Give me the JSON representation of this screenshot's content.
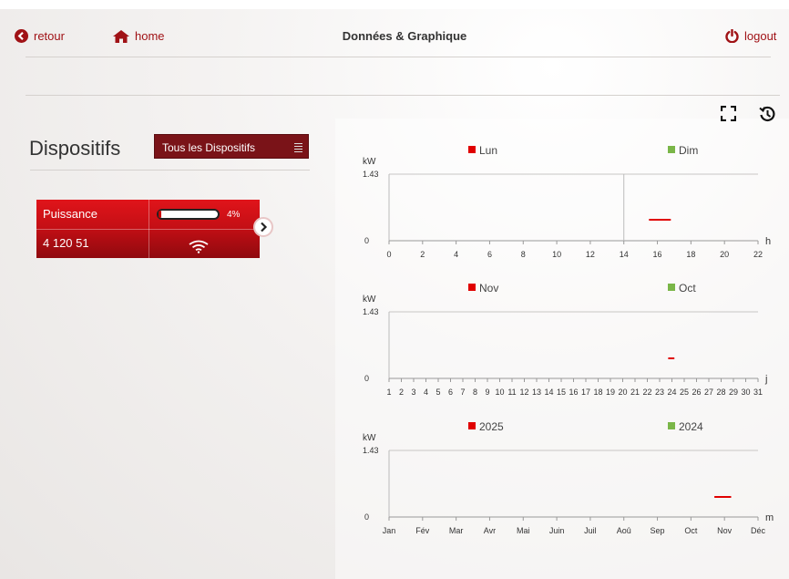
{
  "header": {
    "back_label": "retour",
    "home_label": "home",
    "title": "Données & Graphique",
    "logout_label": "logout"
  },
  "colors": {
    "accent": "#a01216",
    "current": "#e00000",
    "previous": "#7ab648"
  },
  "devices": {
    "title": "Dispositifs",
    "select_value": "Tous les Dispositifs",
    "card": {
      "measure_label": "Puissance",
      "device_id": "4 120 51",
      "battery_percent_label": "4%",
      "battery_level": 0.04
    }
  },
  "toolbar": {
    "fullscreen_icon": "fullscreen-icon",
    "history_icon": "history-icon"
  },
  "chart_data": [
    {
      "type": "line",
      "ylabel": "kW",
      "xlabel": "h",
      "ylim": [
        0,
        1.43
      ],
      "ytick_labels": [
        "1.43",
        "0"
      ],
      "xlim": [
        0,
        22
      ],
      "xtick_labels": [
        "0",
        "2",
        "4",
        "6",
        "8",
        "10",
        "12",
        "14",
        "16",
        "18",
        "20",
        "22"
      ],
      "vline_at": 14,
      "series": [
        {
          "name": "Lun",
          "color": "#e00000",
          "points": [
            [
              15.5,
              0.45
            ],
            [
              16.8,
              0.45
            ]
          ]
        },
        {
          "name": "Dim",
          "color": "#7ab648",
          "points": []
        }
      ]
    },
    {
      "type": "line",
      "ylabel": "kW",
      "xlabel": "j",
      "ylim": [
        0,
        1.43
      ],
      "ytick_labels": [
        "1.43",
        "0"
      ],
      "xlim": [
        1,
        31
      ],
      "xtick_labels": [
        "1",
        "2",
        "3",
        "4",
        "5",
        "6",
        "7",
        "8",
        "9",
        "10",
        "11",
        "12",
        "13",
        "14",
        "15",
        "16",
        "17",
        "18",
        "19",
        "20",
        "21",
        "22",
        "23",
        "24",
        "25",
        "26",
        "27",
        "28",
        "29",
        "30",
        "31"
      ],
      "series": [
        {
          "name": "Nov",
          "color": "#e00000",
          "points": [
            [
              23.7,
              0.43
            ],
            [
              24.2,
              0.43
            ]
          ]
        },
        {
          "name": "Oct",
          "color": "#7ab648",
          "points": []
        }
      ]
    },
    {
      "type": "line",
      "ylabel": "kW",
      "xlabel": "m",
      "ylim": [
        0,
        1.43
      ],
      "ytick_labels": [
        "1.43",
        "0"
      ],
      "xlim": [
        0,
        11
      ],
      "xtick_labels": [
        "Jan",
        "Fév",
        "Mar",
        "Avr",
        "Mai",
        "Juin",
        "Juil",
        "Aoû",
        "Sep",
        "Oct",
        "Nov",
        "Déc"
      ],
      "series": [
        {
          "name": "2025",
          "color": "#e00000",
          "points": [
            [
              9.7,
              0.43
            ],
            [
              10.2,
              0.43
            ]
          ]
        },
        {
          "name": "2024",
          "color": "#7ab648",
          "points": []
        }
      ]
    }
  ]
}
